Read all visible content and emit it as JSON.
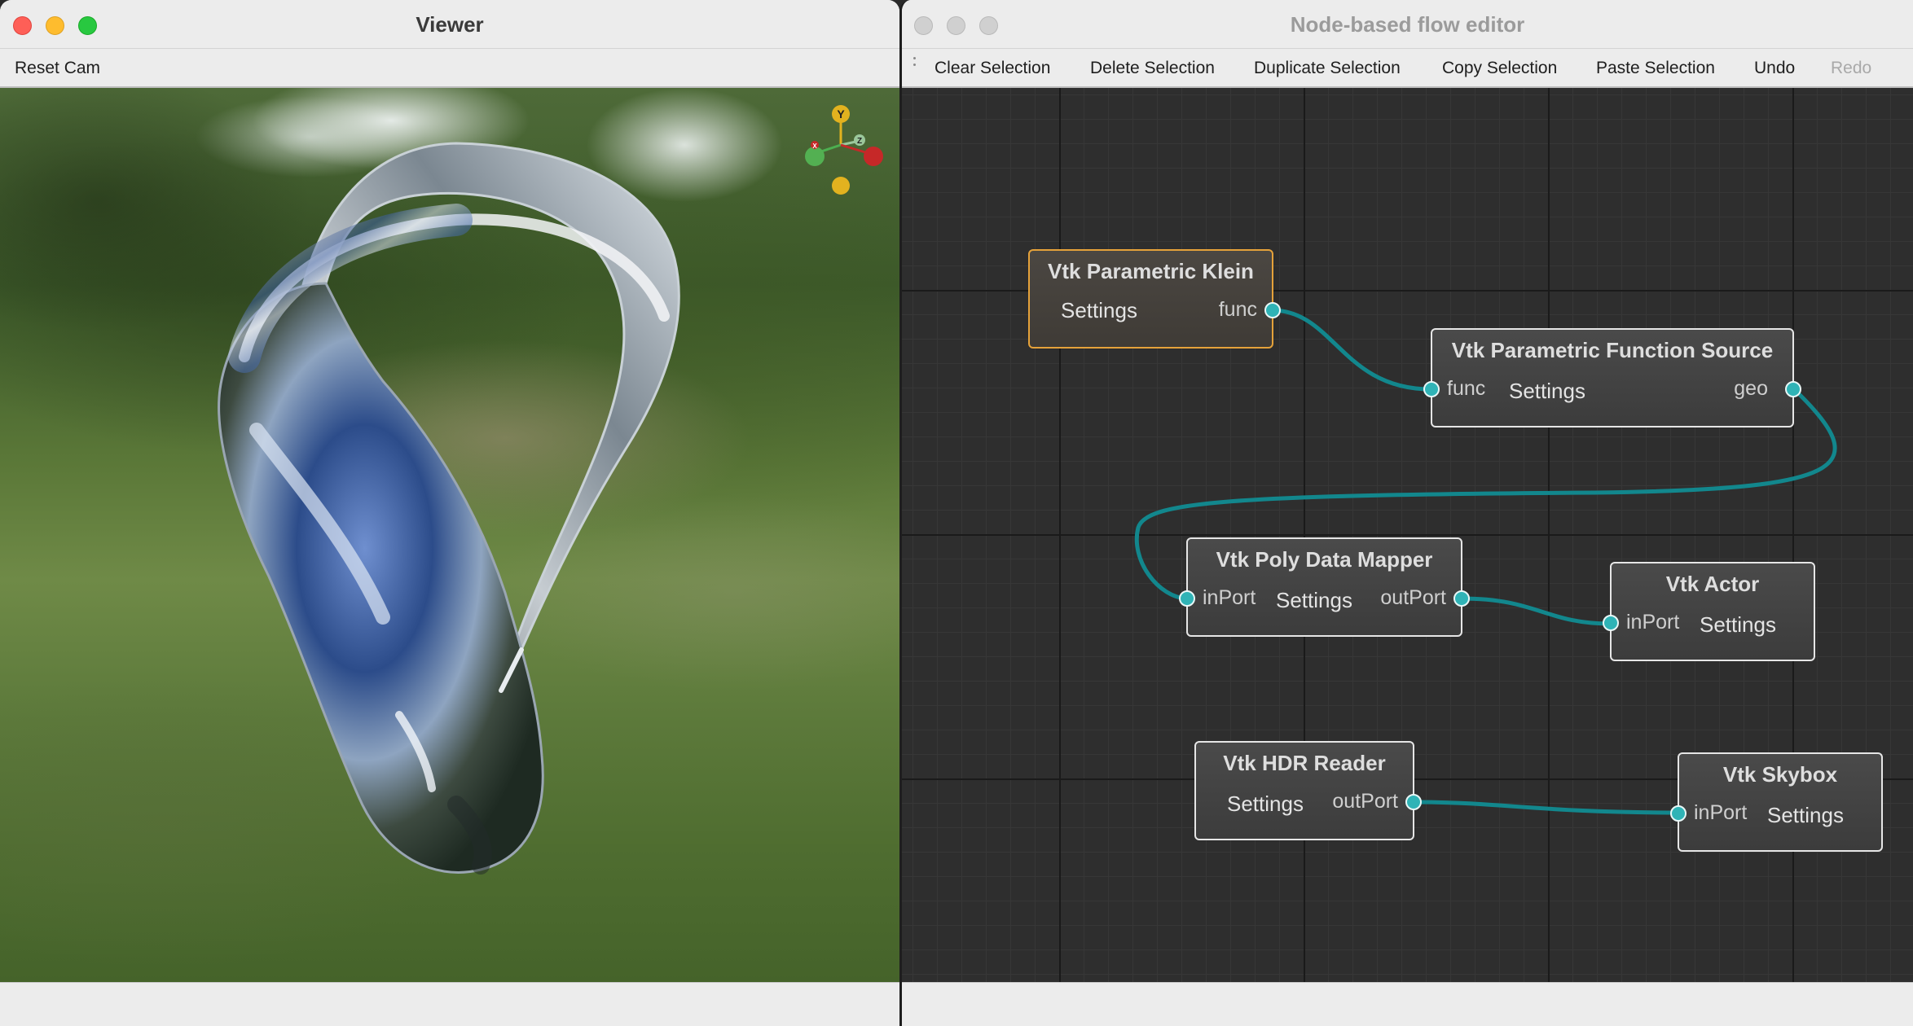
{
  "viewer": {
    "title": "Viewer",
    "toolbar": {
      "reset_cam": "Reset Cam"
    },
    "axes": {
      "y": "Y",
      "x": "X",
      "z": "Z"
    }
  },
  "flow_editor": {
    "title": "Node-based flow editor",
    "toolbar": {
      "clear": "Clear Selection",
      "delete": "Delete Selection",
      "duplicate": "Duplicate Selection",
      "copy": "Copy Selection",
      "paste": "Paste Selection",
      "undo": "Undo",
      "redo": "Redo"
    },
    "nodes": {
      "klein": {
        "title": "Vtk Parametric Klein",
        "settings": "Settings",
        "out": "func"
      },
      "pfs": {
        "title": "Vtk Parametric Function Source",
        "in": "func",
        "settings": "Settings",
        "out": "geo"
      },
      "mapper": {
        "title": "Vtk Poly Data Mapper",
        "in": "inPort",
        "settings": "Settings",
        "out": "outPort"
      },
      "actor": {
        "title": "Vtk Actor",
        "in": "inPort",
        "settings": "Settings"
      },
      "hdr": {
        "title": "Vtk HDR Reader",
        "settings": "Settings",
        "out": "outPort"
      },
      "skybox": {
        "title": "Vtk Skybox",
        "in": "inPort",
        "settings": "Settings"
      }
    }
  },
  "colors": {
    "port": "#2fb3b6",
    "wire": "#12878d",
    "selected_border": "#e5a23a",
    "traffic_red": "#fe5f57",
    "traffic_yellow": "#febc2e",
    "traffic_green": "#28c840",
    "traffic_inactive": "#c8c8c8"
  },
  "icons": [
    "close-button-icon",
    "minimize-button-icon",
    "zoom-button-icon",
    "orientation-axes-icon",
    "toolbar-grip-icon"
  ]
}
